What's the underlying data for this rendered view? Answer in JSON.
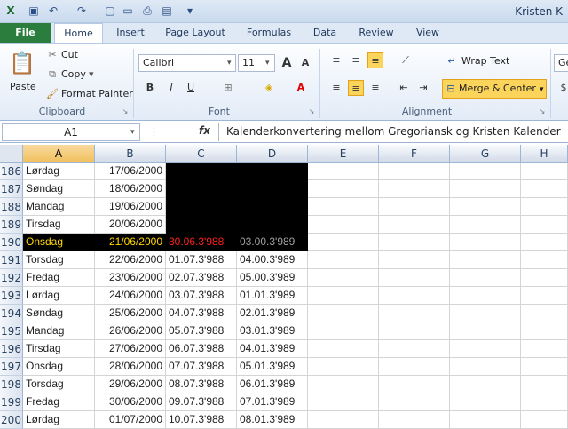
{
  "window": {
    "title": "Kristen K"
  },
  "tabs": [
    "File",
    "Home",
    "Insert",
    "Page Layout",
    "Formulas",
    "Data",
    "Review",
    "View"
  ],
  "clipboard": {
    "paste": "Paste",
    "cut": "Cut",
    "copy": "Copy",
    "format_painter": "Format Painter",
    "label": "Clipboard"
  },
  "font": {
    "name": "Calibri",
    "size": "11",
    "label": "Font"
  },
  "alignment": {
    "wrap_text": "Wrap Text",
    "merge_center": "Merge & Center",
    "label": "Alignment"
  },
  "number_box": "Ge",
  "formula_bar": {
    "name_box": "A1",
    "fx": "fx",
    "content": "Kalenderkonvertering mellom Gregoriansk og Kristen Kalender"
  },
  "columns": [
    "A",
    "B",
    "C",
    "D",
    "E",
    "F",
    "G",
    "H"
  ],
  "rows": [
    {
      "n": "186",
      "a": "Lørdag",
      "b": "17/06/2000",
      "c": "",
      "d": ""
    },
    {
      "n": "187",
      "a": "Søndag",
      "b": "18/06/2000",
      "c": "",
      "d": ""
    },
    {
      "n": "188",
      "a": "Mandag",
      "b": "19/06/2000",
      "c": "",
      "d": ""
    },
    {
      "n": "189",
      "a": "Tirsdag",
      "b": "20/06/2000",
      "c": "",
      "d": ""
    },
    {
      "n": "190",
      "a": "Onsdag",
      "b": "21/06/2000",
      "c": "30.06.3'988",
      "d": "03.00.3'989"
    },
    {
      "n": "191",
      "a": "Torsdag",
      "b": "22/06/2000",
      "c": "01.07.3'988",
      "d": "04.00.3'989"
    },
    {
      "n": "192",
      "a": "Fredag",
      "b": "23/06/2000",
      "c": "02.07.3'988",
      "d": "05.00.3'989"
    },
    {
      "n": "193",
      "a": "Lørdag",
      "b": "24/06/2000",
      "c": "03.07.3'988",
      "d": "01.01.3'989"
    },
    {
      "n": "194",
      "a": "Søndag",
      "b": "25/06/2000",
      "c": "04.07.3'988",
      "d": "02.01.3'989"
    },
    {
      "n": "195",
      "a": "Mandag",
      "b": "26/06/2000",
      "c": "05.07.3'988",
      "d": "03.01.3'989"
    },
    {
      "n": "196",
      "a": "Tirsdag",
      "b": "27/06/2000",
      "c": "06.07.3'988",
      "d": "04.01.3'989"
    },
    {
      "n": "197",
      "a": "Onsdag",
      "b": "28/06/2000",
      "c": "07.07.3'988",
      "d": "05.01.3'989"
    },
    {
      "n": "198",
      "a": "Torsdag",
      "b": "29/06/2000",
      "c": "08.07.3'988",
      "d": "06.01.3'989"
    },
    {
      "n": "199",
      "a": "Fredag",
      "b": "30/06/2000",
      "c": "09.07.3'988",
      "d": "07.01.3'989"
    },
    {
      "n": "200",
      "a": "Lørdag",
      "b": "01/07/2000",
      "c": "10.07.3'988",
      "d": "08.01.3'989"
    }
  ],
  "colors": {
    "highlight_bg": "#000000",
    "highlight_a": "#ffd700",
    "highlight_b": "#ffd700",
    "highlight_c": "#ff2020",
    "highlight_d": "#a0a0a0",
    "file_tab": "#2a7d3c"
  }
}
